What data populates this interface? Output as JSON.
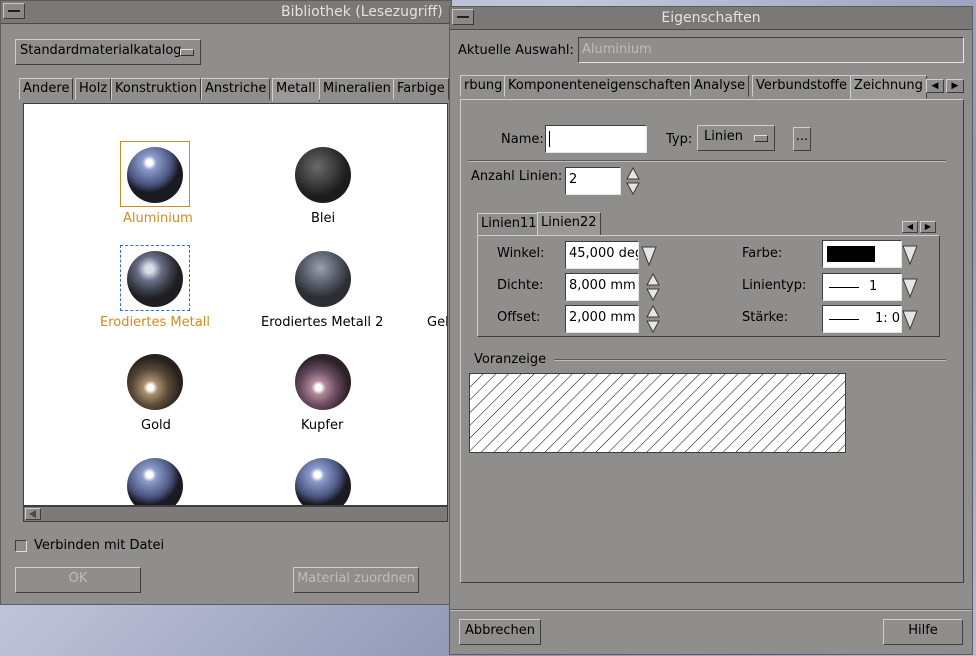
{
  "library": {
    "title": "Bibliothek (Lesezugriff)",
    "catalog_select": "Standardmaterialkatalog",
    "tabs": [
      "Andere",
      "Holz",
      "Konstruktion",
      "Anstriche",
      "Metall",
      "Mineralien",
      "Farbige"
    ],
    "materials": [
      {
        "label": "Aluminium",
        "color": "#d28a23"
      },
      {
        "label": "Blei",
        "color": "#000000"
      },
      {
        "label": "Erodiertes Metall",
        "color": "#d28a23"
      },
      {
        "label": "Erodiertes Metall 2",
        "color": "#000000"
      },
      {
        "label": "Gel",
        "color": "#000000"
      },
      {
        "label": "Gold",
        "color": "#000000"
      },
      {
        "label": "Kupfer",
        "color": "#000000"
      }
    ],
    "link_checkbox": "Verbinden mit Datei",
    "ok_button": "OK",
    "assign_button": "Material zuordnen"
  },
  "properties": {
    "title": "Eigenschaften",
    "current_label": "Aktuelle Auswahl:",
    "current_value": "Aluminium",
    "tabs": [
      "rbung",
      "Komponenteneigenschaften",
      "Analyse",
      "Verbundstoffe",
      "Zeichnung"
    ],
    "name_label": "Name:",
    "name_value": "",
    "type_label": "Typ:",
    "type_value": "Linien",
    "more_button": "...",
    "count_label": "Anzahl Linien:",
    "count_value": "2",
    "line_tabs": [
      "Linien11",
      "Linien22"
    ],
    "angle_label": "Winkel:",
    "angle_value": "45,000 deg",
    "density_label": "Dichte:",
    "density_value": "8,000 mm",
    "offset_label": "Offset:",
    "offset_value": "2,000 mm",
    "color_label": "Farbe:",
    "color_value": "#000000",
    "linetype_label": "Linientyp:",
    "linetype_value": "1",
    "weight_label": "Stärke:",
    "weight_value": "1: 0",
    "preview_label": "Voranzeige",
    "cancel_button": "Abbrechen",
    "help_button": "Hilfe"
  }
}
